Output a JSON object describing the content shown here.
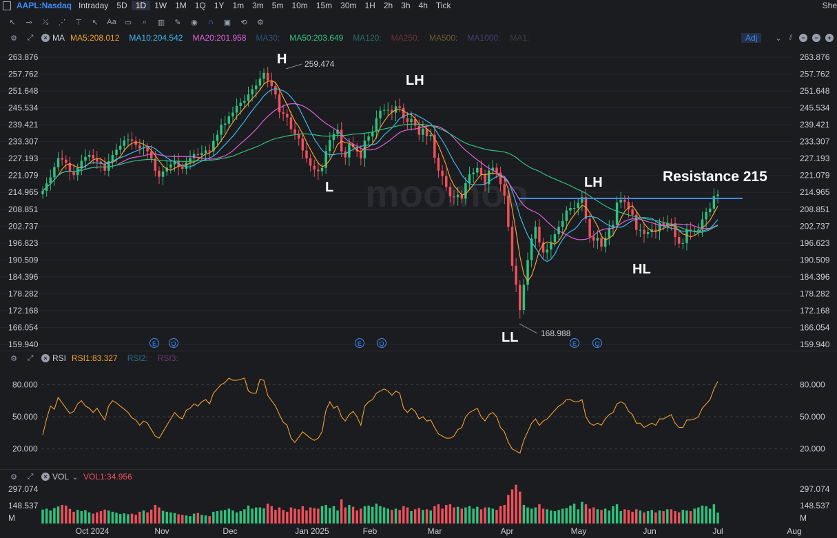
{
  "topbar": {
    "symbol": "AAPL:Nasdaq",
    "intervals": [
      "Intraday",
      "5D",
      "1D",
      "1W",
      "1M",
      "1Q",
      "1Y",
      "1m",
      "3m",
      "5m",
      "10m",
      "15m",
      "30m",
      "1H",
      "2h",
      "3h",
      "4h",
      "Tick"
    ],
    "active_interval": "1D",
    "right_text": "She"
  },
  "ma_bar": {
    "label": "MA",
    "items": [
      {
        "text": "MA5:208.012",
        "color": "#f0a030"
      },
      {
        "text": "MA10:204.542",
        "color": "#3fb6e8"
      },
      {
        "text": "MA20:201.958",
        "color": "#e062d8"
      },
      {
        "text": "MA30:",
        "color": "#2f4f7a"
      },
      {
        "text": "MA50:203.649",
        "color": "#2ec27e"
      },
      {
        "text": "MA120:",
        "color": "#2a6b66"
      },
      {
        "text": "MA250:",
        "color": "#6b3232"
      },
      {
        "text": "MA500:",
        "color": "#6b5a2a"
      },
      {
        "text": "MA1000:",
        "color": "#4a3a6b"
      },
      {
        "text": "MA1:",
        "color": "#3a3d44"
      }
    ],
    "adj": "Adj"
  },
  "price_axis": [
    "263.876",
    "257.762",
    "251.648",
    "245.534",
    "239.421",
    "233.307",
    "227.193",
    "221.079",
    "214.965",
    "208.851",
    "202.737",
    "196.623",
    "190.509",
    "184.396",
    "178.282",
    "172.168",
    "166.054",
    "159.940"
  ],
  "annotations": {
    "H": "H",
    "L": "L",
    "LH1": "LH",
    "LH2": "LH",
    "LL": "LL",
    "HL": "HL",
    "resistance": "Resistance 215",
    "high_value": "259.474",
    "low_value": "168.988"
  },
  "watermark": "moomoo",
  "rsi": {
    "label": "RSI",
    "items": [
      {
        "text": "RSI1:83.327",
        "color": "#f0a030"
      },
      {
        "text": "RSI2:",
        "color": "#2a6b8a"
      },
      {
        "text": "RSI3:",
        "color": "#6b3a6b"
      }
    ],
    "axis": [
      "80.000",
      "50.000",
      "20.000"
    ]
  },
  "vol": {
    "label": "VOL",
    "value": "VOL1:34.956",
    "value_color": "#f0505a",
    "axis": [
      "297.074",
      "148.537",
      "M"
    ]
  },
  "x_axis": [
    "Oct 2024",
    "Nov",
    "Dec",
    "Jan 2025",
    "Feb",
    "Mar",
    "Apr",
    "May",
    "Jun",
    "Jul",
    "Aug"
  ],
  "event_markers": [
    "E",
    "Q",
    "E",
    "Q",
    "E",
    "Q"
  ],
  "chart_data": {
    "type": "candlestick",
    "symbol": "AAPL:Nasdaq",
    "interval": "1D",
    "price_range": [
      159.94,
      263.876
    ],
    "close": [
      215.5,
      218.2,
      220.4,
      224.1,
      227.4,
      226.8,
      225.6,
      222.4,
      221.2,
      223.8,
      226.4,
      227.8,
      228.5,
      227.2,
      226.1,
      225.4,
      222.8,
      226.2,
      228.5,
      230.4,
      231.8,
      233.8,
      234.1,
      233.6,
      232.1,
      230.9,
      231.2,
      229.8,
      227.2,
      222.8,
      220.6,
      222.5,
      223.9,
      225.1,
      226.4,
      224.2,
      223.5,
      225.8,
      227.4,
      228.8,
      228.5,
      229.2,
      230.1,
      229.8,
      233.6,
      235.8,
      239.4,
      239.8,
      242.5,
      243.8,
      246.2,
      247.4,
      248.1,
      250.4,
      252.3,
      253.6,
      256.1,
      258.2,
      255.5,
      253.4,
      250.4,
      243.9,
      243.4,
      242.1,
      237.8,
      236.1,
      234.4,
      230.1,
      227.3,
      224.6,
      223.2,
      222.6,
      223.8,
      229.9,
      233.9,
      236.1,
      237.6,
      229.8,
      227.6,
      232.4,
      231.3,
      229.8,
      227.3,
      233.7,
      235.2,
      236.9,
      241.8,
      244.5,
      244.8,
      244.8,
      243.8,
      246.1,
      245.5,
      241.8,
      240.4,
      241.5,
      239.1,
      235.8,
      238.0,
      235.3,
      235.8,
      227.5,
      222.8,
      220.8,
      216.9,
      213.5,
      213.2,
      214.1,
      212.7,
      218.3,
      221.5,
      222.1,
      223.8,
      221.5,
      217.9,
      222.9,
      223.9,
      222.1,
      217.9,
      213.8,
      202.5,
      188.4,
      181.5,
      172.4,
      181.5,
      190.4,
      198.2,
      202.5,
      196.9,
      193.2,
      194.3,
      196.9,
      199.8,
      202.5,
      204.6,
      208.4,
      209.3,
      209.3,
      211.2,
      213.3,
      205.4,
      198.9,
      197.5,
      198.5,
      195.3,
      198.5,
      202.1,
      203.2,
      211.3,
      212.3,
      211.5,
      208.8,
      206.9,
      201.4,
      201.4,
      199.9,
      200.6,
      201.5,
      200.8,
      203.9,
      202.8,
      203.9,
      203.8,
      198.8,
      196.4,
      196.6,
      201.5,
      201.0,
      201.1,
      201.5,
      205.2,
      207.8,
      209.1,
      213.6,
      214.2
    ],
    "rsi": [
      33,
      48,
      60,
      57,
      68,
      63,
      58,
      53,
      55,
      62,
      65,
      60,
      58,
      54,
      58,
      52,
      47,
      60,
      65,
      63,
      60,
      57,
      54,
      49,
      47,
      42,
      46,
      44,
      38,
      32,
      30,
      36,
      42,
      48,
      54,
      50,
      48,
      56,
      58,
      62,
      60,
      64,
      66,
      62,
      72,
      76,
      80,
      82,
      86,
      84,
      84,
      85,
      86,
      74,
      72,
      72,
      85,
      84,
      70,
      65,
      60,
      52,
      45,
      42,
      30,
      26,
      31,
      36,
      33,
      30,
      28,
      30,
      36,
      56,
      64,
      58,
      60,
      50,
      46,
      52,
      55,
      50,
      42,
      60,
      64,
      66,
      72,
      74,
      76,
      74,
      70,
      74,
      72,
      58,
      54,
      58,
      55,
      48,
      50,
      46,
      47,
      40,
      34,
      32,
      30,
      30,
      32,
      38,
      40,
      50,
      54,
      56,
      58,
      50,
      46,
      52,
      54,
      50,
      40,
      36,
      26,
      20,
      18,
      16,
      28,
      36,
      44,
      48,
      42,
      46,
      48,
      52,
      56,
      60,
      62,
      66,
      66,
      64,
      64,
      66,
      50,
      44,
      42,
      44,
      42,
      48,
      52,
      54,
      62,
      64,
      62,
      55,
      52,
      44,
      44,
      40,
      42,
      44,
      42,
      48,
      48,
      50,
      52,
      44,
      40,
      40,
      47,
      47,
      48,
      50,
      58,
      62,
      66,
      76,
      83
    ],
    "volume": [
      45,
      48,
      42,
      50,
      55,
      60,
      58,
      35,
      38,
      44,
      40,
      43,
      36,
      32,
      36,
      40,
      45,
      42,
      38,
      35,
      31,
      33,
      30,
      32,
      28,
      38,
      42,
      36,
      45,
      60,
      52,
      41,
      38,
      36,
      34,
      30,
      28,
      26,
      24,
      32,
      34,
      28,
      26,
      24,
      38,
      40,
      42,
      44,
      48,
      42,
      36,
      40,
      46,
      58,
      48,
      52,
      52,
      49,
      64,
      56,
      44,
      52,
      44,
      38,
      52,
      48,
      46,
      56,
      42,
      52,
      50,
      48,
      56,
      60,
      50,
      56,
      42,
      78,
      52,
      60,
      54,
      42,
      48,
      56,
      58,
      54,
      64,
      56,
      52,
      48,
      44,
      48,
      44,
      56,
      52,
      40,
      46,
      50,
      44,
      46,
      42,
      56,
      62,
      48,
      60,
      62,
      52,
      54,
      48,
      52,
      56,
      48,
      54,
      46,
      52,
      52,
      48,
      44,
      56,
      60,
      92,
      110,
      125,
      103,
      60,
      52,
      48,
      52,
      62,
      48,
      46,
      42,
      40,
      44,
      48,
      50,
      58,
      64,
      46,
      70,
      62,
      48,
      52,
      46,
      44,
      48,
      42,
      56,
      62,
      40,
      46,
      44,
      38,
      46,
      42,
      36,
      40,
      44,
      36,
      42,
      40,
      46,
      46,
      40,
      36,
      44,
      42,
      40,
      48,
      52,
      58,
      56,
      48,
      62,
      35
    ],
    "ma_series": [
      "MA5",
      "MA10",
      "MA20",
      "MA50"
    ],
    "resistance_level": 215,
    "volume_axis_max": 297.074,
    "rsi_axis": [
      20,
      50,
      80
    ]
  }
}
